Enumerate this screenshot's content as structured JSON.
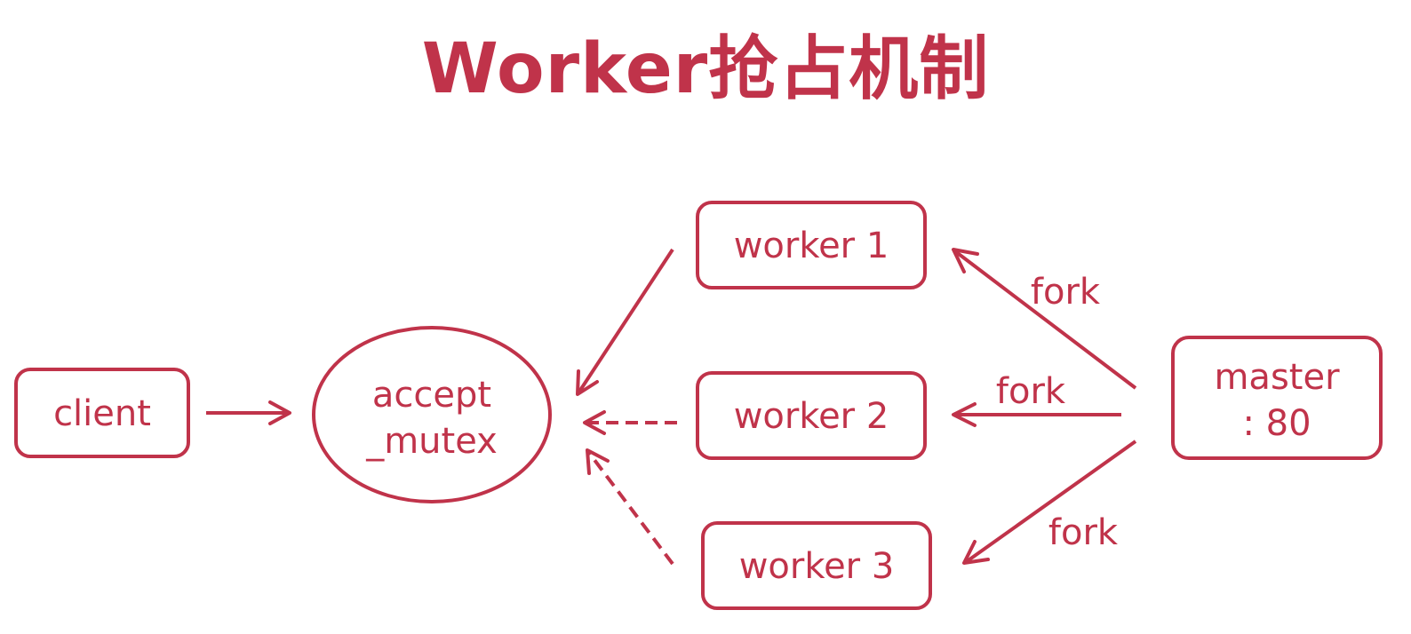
{
  "title": "Worker抢占机制",
  "colors": {
    "accent": "#c0334a"
  },
  "nodes": {
    "client": {
      "label": "client"
    },
    "accept_mutex": {
      "line1": "accept",
      "line2": "_mutex"
    },
    "worker1": {
      "label": "worker 1"
    },
    "worker2": {
      "label": "worker 2"
    },
    "worker3": {
      "label": "worker 3"
    },
    "master": {
      "line1": "master",
      "line2": ": 80"
    }
  },
  "edges": {
    "fork1": "fork",
    "fork2": "fork",
    "fork3": "fork"
  }
}
